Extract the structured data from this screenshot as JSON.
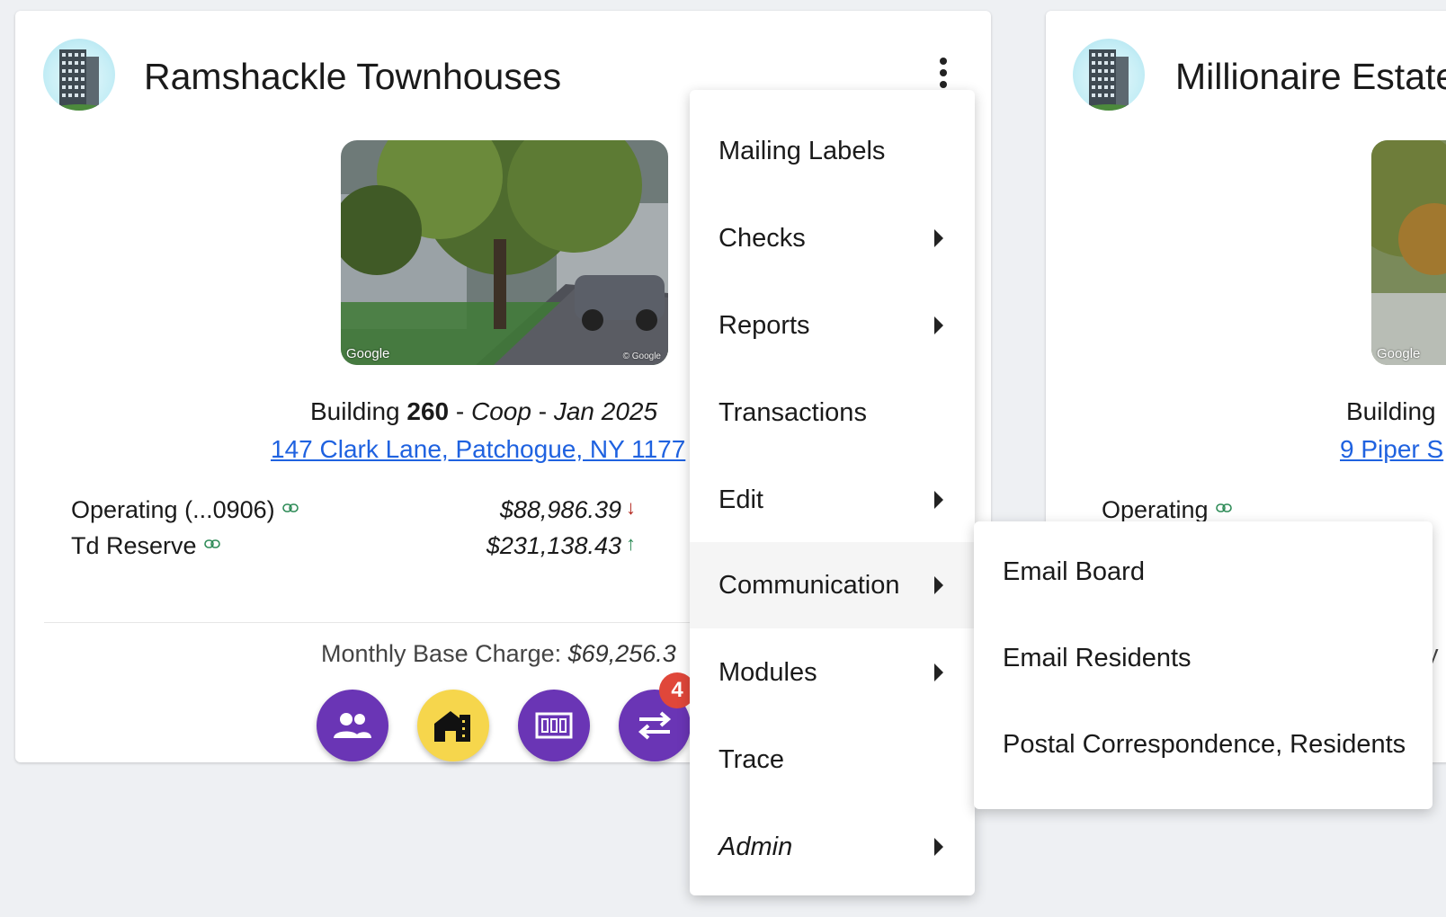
{
  "cards": [
    {
      "title": "Ramshackle Townhouses",
      "photo_label": "Google",
      "photo_copyright": "© Google",
      "building_prefix": "Building ",
      "building_number": "260",
      "building_sep1": " - ",
      "building_type": "Coop",
      "building_sep2": " - ",
      "building_date": "Jan 2025",
      "address": "147 Clark Lane, Patchogue, NY 1177",
      "accounts": [
        {
          "name": "Operating (...0906)",
          "amount": "$88,986.39",
          "trend": "↓",
          "trend_color": "#b3261e"
        },
        {
          "name": "Td Reserve",
          "amount": "$231,138.43",
          "trend": "↑",
          "trend_color": "#2e8b57"
        }
      ],
      "monthly_label": "Monthly Base Charge: ",
      "monthly_value": "$69,256.3",
      "notification_count": "4"
    },
    {
      "title": "Millionaire Estates",
      "photo_label": "Google",
      "building_prefix": "Building",
      "address": "9 Piper S",
      "accounts": [
        {
          "name": "Operating"
        }
      ],
      "monthly_fragment": "y"
    }
  ],
  "menu": {
    "items": [
      {
        "label": "Mailing Labels",
        "has_submenu": false
      },
      {
        "label": "Checks",
        "has_submenu": true
      },
      {
        "label": "Reports",
        "has_submenu": true
      },
      {
        "label": "Transactions",
        "has_submenu": false
      },
      {
        "label": "Edit",
        "has_submenu": true
      },
      {
        "label": "Communication",
        "has_submenu": true,
        "active": true
      },
      {
        "label": "Modules",
        "has_submenu": true
      },
      {
        "label": "Trace",
        "has_submenu": false
      },
      {
        "label": "Admin",
        "has_submenu": true,
        "italic": true
      }
    ]
  },
  "submenu": {
    "items": [
      {
        "label": "Email Board"
      },
      {
        "label": "Email Residents"
      },
      {
        "label": "Postal Correspondence, Residents"
      }
    ]
  },
  "colors": {
    "fab_purple": "#6a35b5",
    "fab_yellow": "#f6d64c",
    "link": "#1f62e0",
    "badge": "#e0473a"
  },
  "icons": [
    "building-icon",
    "kebab-menu-icon",
    "link-icon",
    "people-icon",
    "house-icon",
    "counter-icon",
    "swap-icon",
    "caret-right-icon"
  ]
}
